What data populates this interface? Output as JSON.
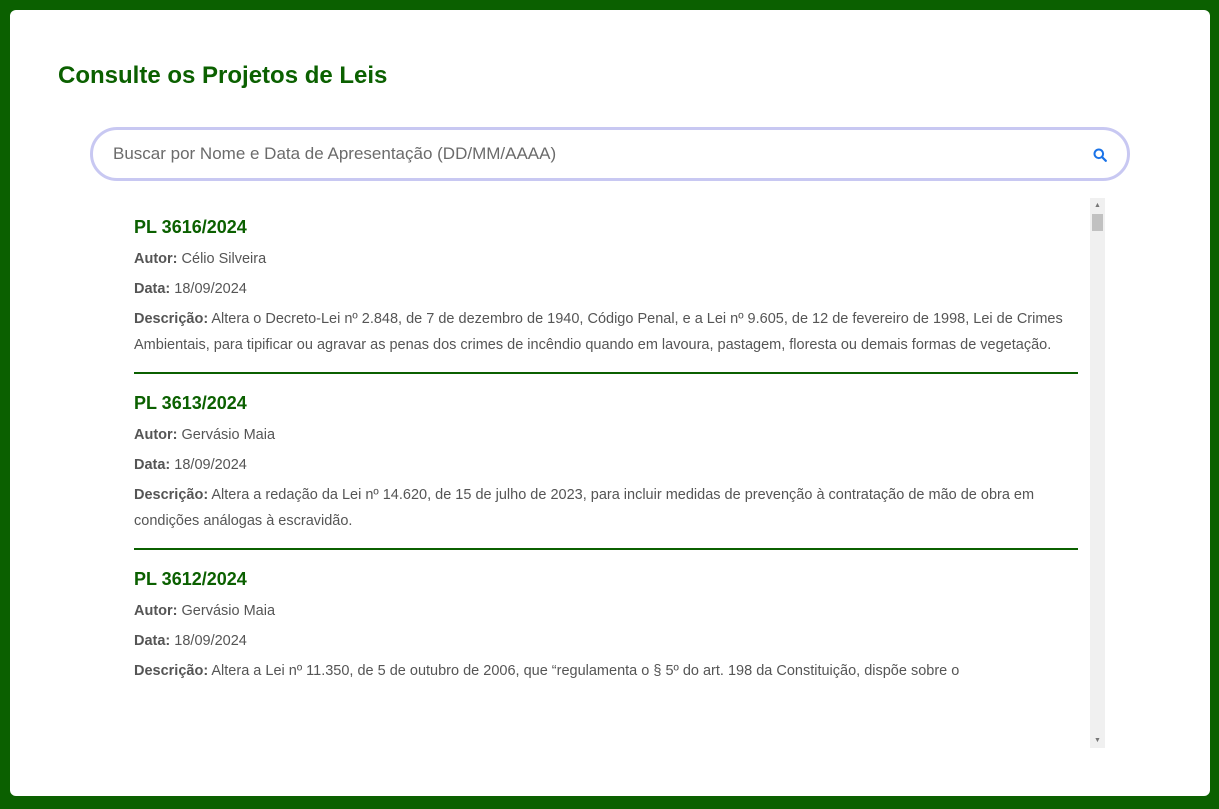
{
  "page": {
    "title": "Consulte os Projetos de Leis"
  },
  "search": {
    "placeholder": "Buscar por Nome e Data de Apresentação (DD/MM/AAAA)",
    "icon": "search-icon"
  },
  "labels": {
    "author": "Autor:",
    "date": "Data:",
    "description": "Descrição:"
  },
  "projects": [
    {
      "title": "PL 3616/2024",
      "author": "Célio Silveira",
      "date": "18/09/2024",
      "description": "Altera o Decreto-Lei nº 2.848, de 7 de dezembro de 1940, Código Penal, e a Lei nº 9.605, de 12 de fevereiro de 1998, Lei de Crimes Ambientais, para tipificar ou agravar as penas dos crimes de incêndio quando em lavoura, pastagem, floresta ou demais formas de vegetação."
    },
    {
      "title": "PL 3613/2024",
      "author": "Gervásio Maia",
      "date": "18/09/2024",
      "description": "Altera a redação da Lei nº 14.620, de 15 de julho de 2023, para incluir medidas de prevenção à contratação de mão de obra em condições análogas à escravidão."
    },
    {
      "title": "PL 3612/2024",
      "author": "Gervásio Maia",
      "date": "18/09/2024",
      "description": "Altera a Lei nº 11.350, de 5 de outubro de 2006, que “regulamenta o § 5º do art. 198 da Constituição, dispõe sobre o"
    }
  ],
  "colors": {
    "brand": "#0b6000",
    "search_border": "#c8c8f2",
    "search_icon": "#1a73e8"
  }
}
